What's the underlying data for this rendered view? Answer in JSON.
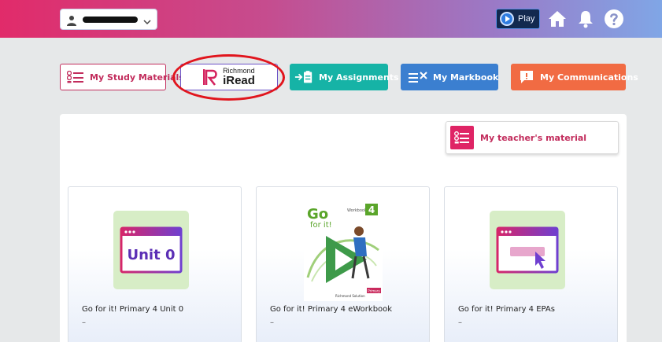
{
  "header": {
    "user_name": "■■■■■■■■■■",
    "play_label": "Play",
    "icons": [
      "user-icon",
      "chevron-down-icon",
      "play-icon",
      "home-icon",
      "bell-icon",
      "help-icon"
    ]
  },
  "tabs": {
    "study_label": "My Study Materials",
    "iread_small": "Richmond",
    "iread_big": "iRead",
    "assign_label": "My Assignments",
    "mark_label": "My Markbook",
    "comm_label": "My Communications"
  },
  "panel": {
    "teacher_label": "My teacher's material"
  },
  "cards": [
    {
      "title": "Go for it! Primary 4 Unit 0",
      "sub": "–",
      "thumb_text": "Unit 0"
    },
    {
      "title": "Go for it! Primary 4 eWorkbook",
      "sub": "–",
      "cover_title1": "Go",
      "cover_title2": "for it!",
      "cover_num": "4",
      "cover_small": "Workbook",
      "cover_badge": "Primary",
      "cover_publisher": "Richmond Solution"
    },
    {
      "title": "Go for it! Primary 4 EPAs",
      "sub": "–"
    }
  ],
  "colors": {
    "brand_pink": "#c22c5c",
    "iread_purple": "#6c52c6",
    "teal": "#16b3a6",
    "blue": "#3b7fd0",
    "orange": "#f16b43",
    "highlight_red": "#e1151d"
  }
}
